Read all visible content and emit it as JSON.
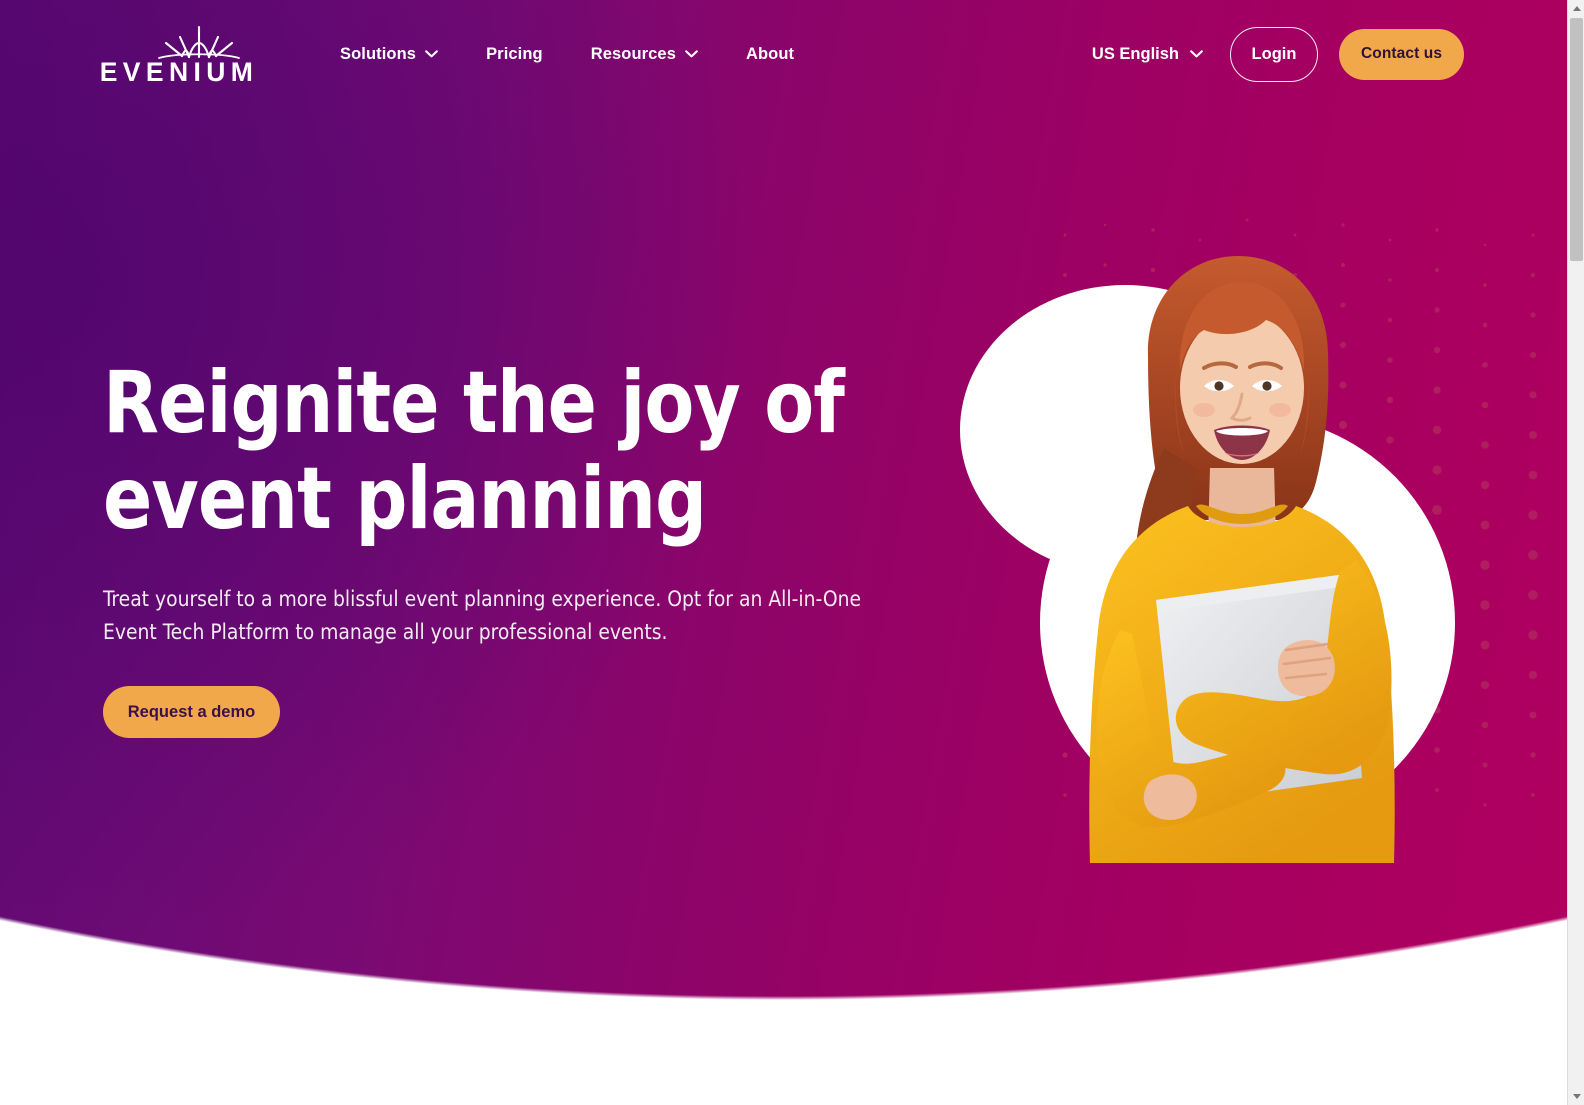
{
  "brand": {
    "name": "EVENIUM",
    "logo_icon": "evenium-starburst-logo",
    "accent_orange": "#f0a84a",
    "purple_left": "#5b0a70",
    "magenta_right": "#b00060",
    "text_on_orange": "#3d0f4a"
  },
  "header": {
    "nav": [
      {
        "label": "Solutions",
        "has_dropdown": true,
        "icon": "chevron-down-icon"
      },
      {
        "label": "Pricing",
        "has_dropdown": false,
        "icon": ""
      },
      {
        "label": "Resources",
        "has_dropdown": true,
        "icon": "chevron-down-icon"
      },
      {
        "label": "About",
        "has_dropdown": false,
        "icon": ""
      }
    ],
    "language": {
      "label": "US English",
      "icon": "chevron-down-icon"
    },
    "login_label": "Login",
    "contact_label": "Contact us"
  },
  "hero": {
    "headline": "Reignite the joy of\nevent planning",
    "subhead": "Treat yourself to a more blissful event planning experience. Opt for an All-in-One Event Tech Platform to manage all your professional events.",
    "cta_label": "Request a demo",
    "art": {
      "description": "smiling woman in yellow sweater holding a silver laptop",
      "sweater_color": "#f5b21c",
      "hair_color": "#b5482a",
      "laptop_color": "#d8dadd",
      "blob_color": "#ffffff",
      "halftone_color": "#b0205e"
    }
  },
  "browser": {
    "scrollbar": {
      "icon_up": "scroll-up-arrow-icon",
      "icon_down": "scroll-down-arrow-icon"
    }
  }
}
